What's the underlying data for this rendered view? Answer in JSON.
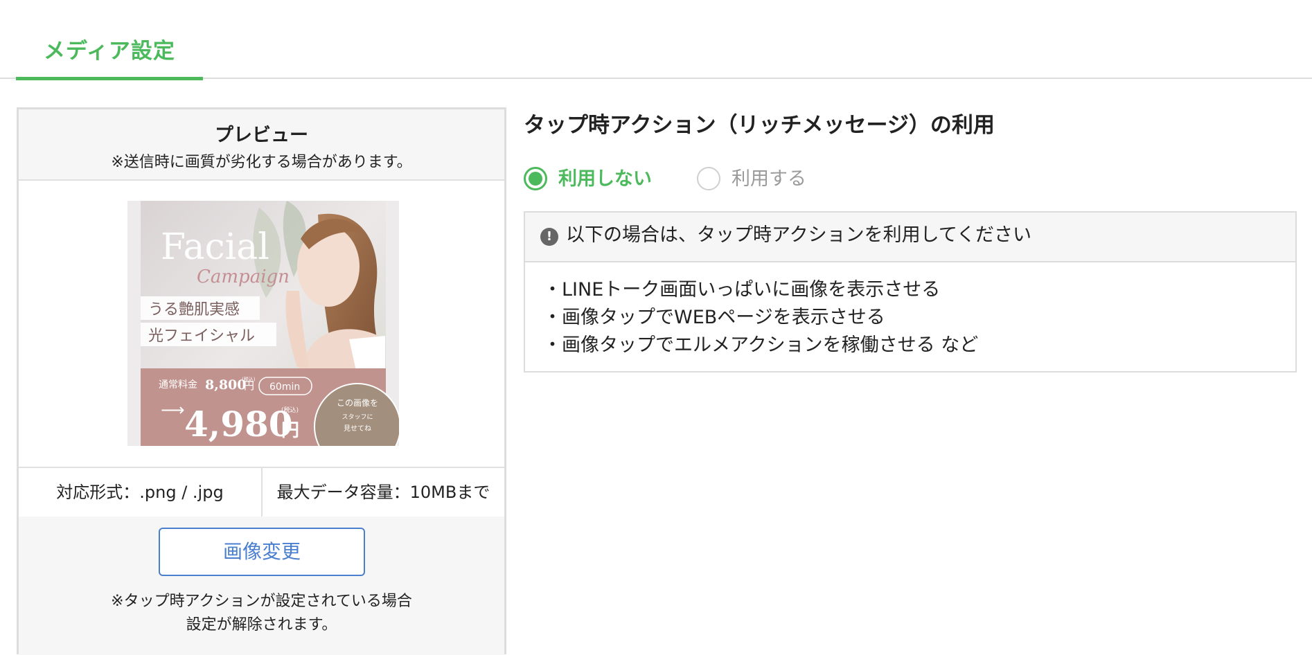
{
  "tabs": [
    {
      "label": "メディア設定",
      "active": true
    }
  ],
  "preview": {
    "title": "プレビュー",
    "note": "※送信時に画質が劣化する場合があります。",
    "image": {
      "subject": "photo of a woman touching her cheek",
      "headline": "Facial",
      "script": "Campaign",
      "tag1": "うる艶肌実感",
      "tag2": "光フェイシャル",
      "regular_label": "通常料金",
      "regular_price": "8,800",
      "regular_yen": "円",
      "regular_tax": "(税込)",
      "duration": "60min",
      "arrow": "⟶",
      "sale_price": "4,980",
      "sale_tax": "(税込)",
      "sale_yen": "円",
      "badge_line1": "この画像を",
      "badge_line2": "スタッフに",
      "badge_line3": "見せてね"
    },
    "formats": "対応形式：.png / .jpg",
    "max_size": "最大データ容量：10MBまで",
    "change_button": "画像変更",
    "footer_note_line1": "※タップ時アクションが設定されている場合",
    "footer_note_line2": "設定が解除されます。"
  },
  "action": {
    "title": "タップ時アクション（リッチメッセージ）の利用",
    "options": [
      {
        "label": "利用しない",
        "selected": true
      },
      {
        "label": "利用する",
        "selected": false
      }
    ],
    "notice": {
      "icon": "exclamation-icon",
      "title": "以下の場合は、タップ時アクションを利用してください",
      "items": [
        "・LINEトーク画面いっぱいに画像を表示させる",
        "・画像タップでWEBページを表示させる",
        "・画像タップでエルメアクションを稼働させる など"
      ]
    }
  },
  "colors": {
    "accent": "#4cba5c",
    "button_blue": "#4a7fd0",
    "panel_bg": "#f6f6f6",
    "image_pink": "#c0938f"
  }
}
